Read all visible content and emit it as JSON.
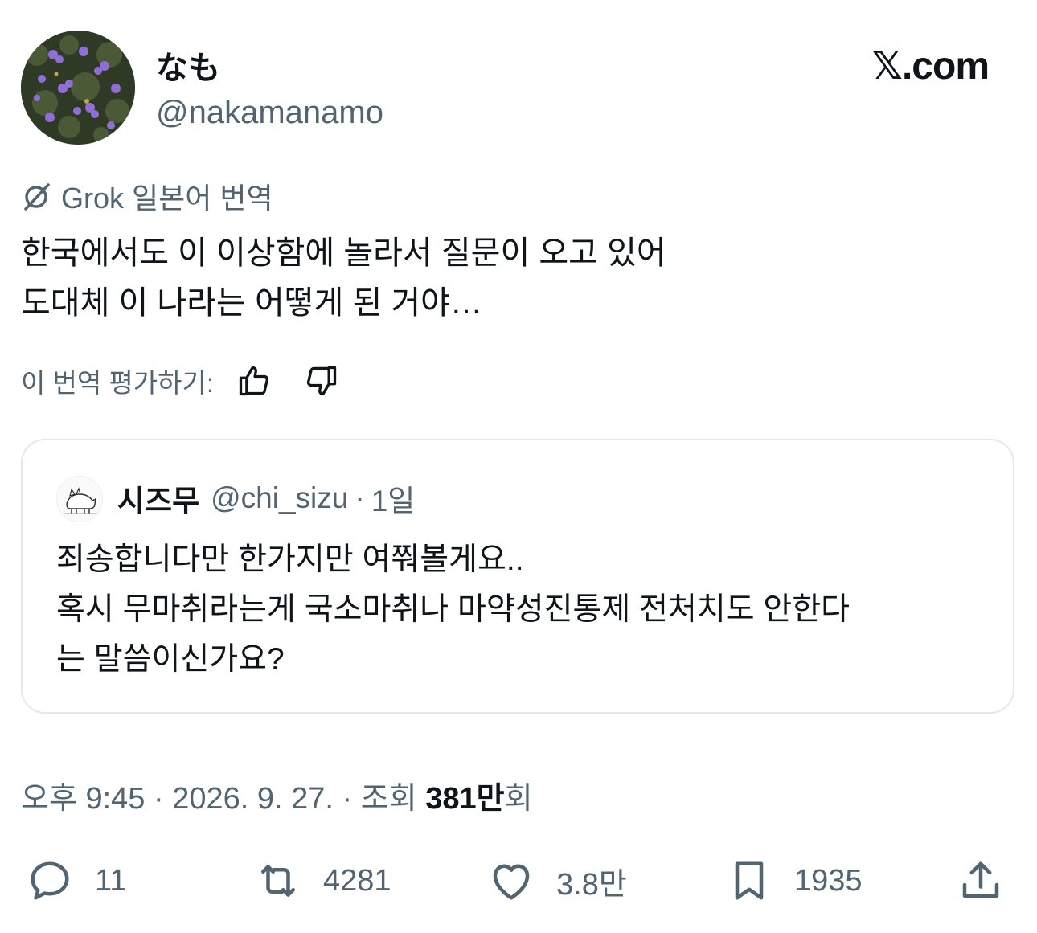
{
  "author": {
    "display_name": "なも",
    "handle": "@nakamanamo",
    "avatar_icon": "flower-avatar-icon"
  },
  "brand": {
    "x_glyph": "𝕏",
    "suffix": ".com"
  },
  "translation": {
    "label": "Grok 일본어 번역",
    "icon": "grok-icon"
  },
  "tweet": {
    "lines": [
      "한국에서도 이 이상함에 놀라서 질문이 오고 있어",
      "도대체 이 나라는 어떻게 된 거야…"
    ]
  },
  "rating": {
    "label": "이 번역 평가하기:",
    "up_icon": "thumbs-up-icon",
    "down_icon": "thumbs-down-icon"
  },
  "quote": {
    "display_name": "시즈무",
    "handle": "@chi_sizu",
    "separator": "·",
    "time": "1일",
    "lines": [
      "죄송합니다만 한가지만 여쭤볼게요..",
      "혹시 무마취라는게 국소마취나 마약성진통제 전처치도 안한다",
      "는 말씀이신가요?"
    ]
  },
  "meta": {
    "prefix": "오후 9:45 · 2026. 9. 27. · 조회 ",
    "views": "381만",
    "suffix": "회"
  },
  "actions": {
    "reply_count": "11",
    "retweet_count": "4281",
    "like_count": "3.8만",
    "bookmark_count": "1935"
  },
  "colors": {
    "text": "#0f1419",
    "secondary": "#536471",
    "border": "#e4e8eb"
  }
}
